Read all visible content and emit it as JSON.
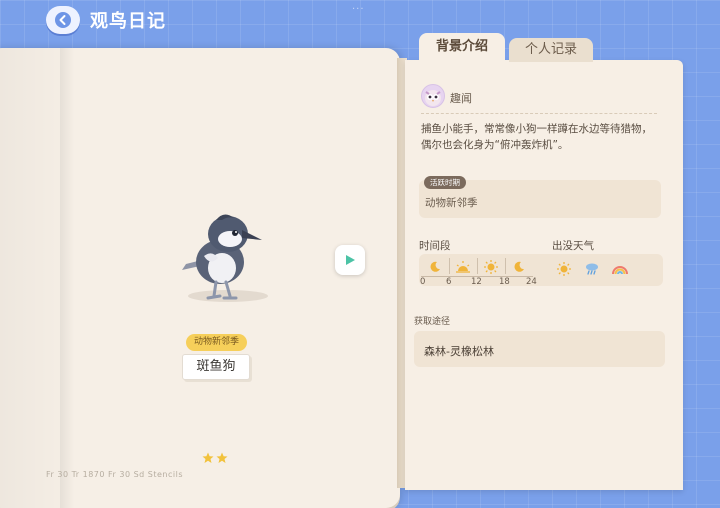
{
  "header": {
    "title": "观鸟日记",
    "drag_handle": "···"
  },
  "tabs": [
    {
      "label": "背景介绍",
      "active": true
    },
    {
      "label": "个人记录",
      "active": false
    }
  ],
  "left_page": {
    "season_tag": "动物新邻季",
    "bird_name": "斑鱼狗",
    "stars": 2,
    "bottom_info": "Fr 30   Tr 1870   Fr 30   Sd Stencils"
  },
  "right_page": {
    "fun_label": "趣闻",
    "description": "捕鱼小能手，常常像小狗一样蹲在水边等待猎物，偶尔也会化身为“俯冲轰炸机”。",
    "active_time_tag": "活跃时期",
    "active_time_value": "动物新邻季",
    "time_label": "时间段",
    "time_ticks": [
      "0",
      "6",
      "12",
      "18",
      "24"
    ],
    "time_icons": [
      "moon-icon",
      "sunrise-icon",
      "sun-icon",
      "moon-icon"
    ],
    "weather_label": "出没天气",
    "weather_icons": [
      "sunny-icon",
      "rain-icon",
      "rainbow-icon"
    ],
    "obtain_label": "获取途径",
    "obtain_value": "森林-灵橡松林"
  },
  "colors": {
    "background": "#7aa0ea",
    "page": "#f7efe5",
    "panel": "#f0e4d4",
    "season_tag": "#f6cf5a",
    "star": "#f2c23c",
    "play_icon": "#4cc3a6"
  }
}
